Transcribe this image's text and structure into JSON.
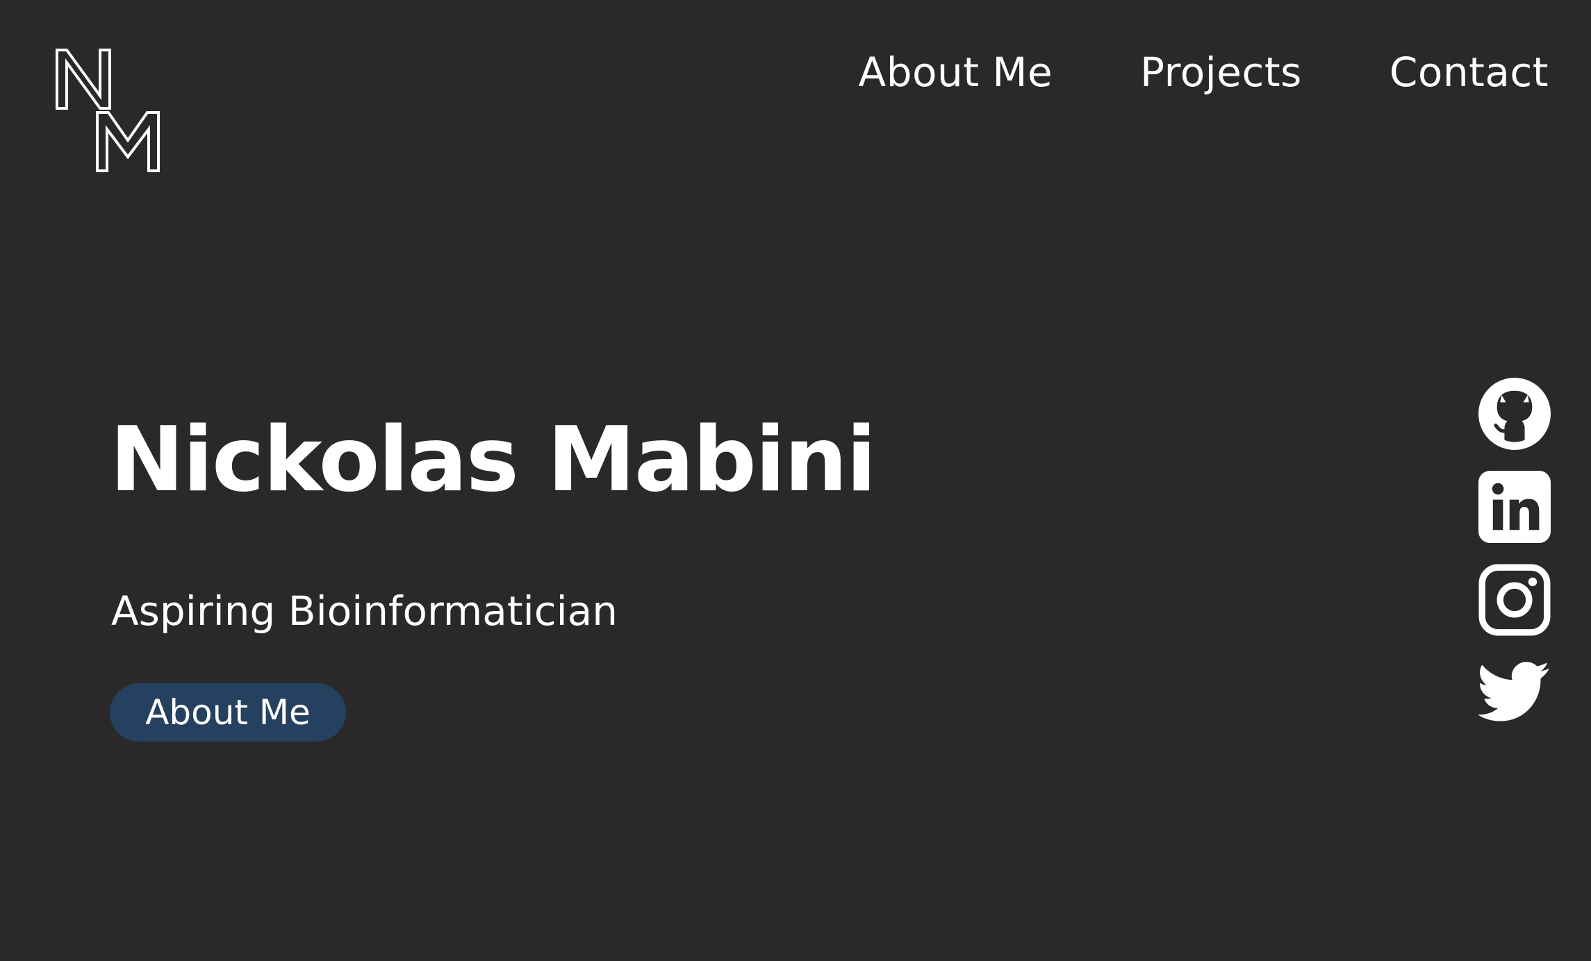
{
  "logo": {
    "letters": [
      "N",
      "M"
    ],
    "icon": "nm-monogram-logo"
  },
  "nav": {
    "items": [
      {
        "label": "About Me"
      },
      {
        "label": "Projects"
      },
      {
        "label": "Contact"
      }
    ]
  },
  "hero": {
    "title": "Nickolas Mabini",
    "subtitle": "Aspiring Bioinformatician",
    "button_label": "About Me"
  },
  "socials": [
    {
      "icon": "github-icon"
    },
    {
      "icon": "linkedin-icon"
    },
    {
      "icon": "instagram-icon"
    },
    {
      "icon": "twitter-icon"
    }
  ],
  "colors": {
    "background": "#2a2829",
    "text": "#ffffff",
    "button": "#26405f"
  }
}
